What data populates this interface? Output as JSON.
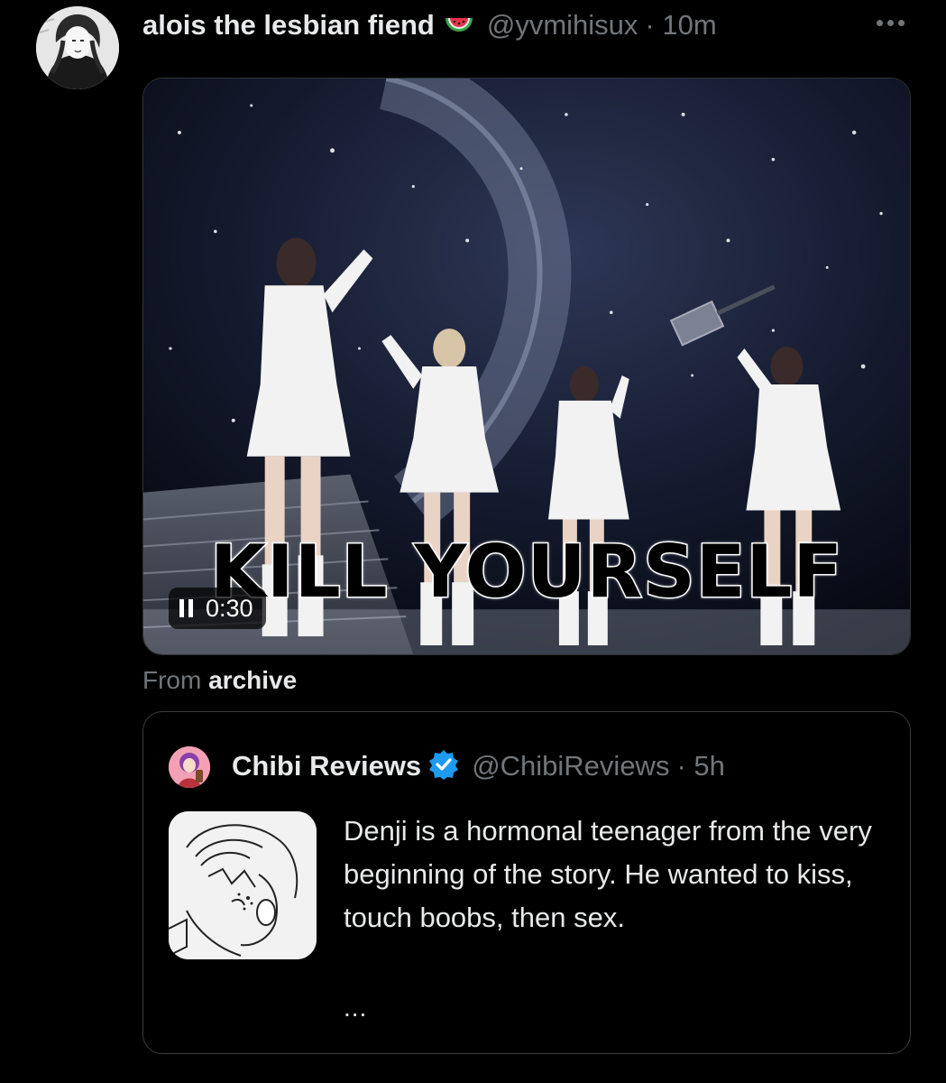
{
  "post": {
    "author_name": "alois the lesbian fiend",
    "author_emoji": "watermelon-icon",
    "handle": "@yvmihisux",
    "time": "· 10m",
    "more_icon": "more-horizontal-icon"
  },
  "video": {
    "caption": "KILL YOURSELF",
    "time_label": "0:30",
    "state_icon": "pause-icon"
  },
  "source": {
    "prefix": "From",
    "name": "archive"
  },
  "quote": {
    "name": "Chibi Reviews",
    "verified_icon": "verified-badge-icon",
    "handle": "@ChibiReviews",
    "time": "· 5h",
    "text": "Denji is a hormonal teenager from the very beginning of the story. He wanted to kiss, touch boobs, then sex.",
    "ellipsis": "..."
  },
  "colors": {
    "background": "#000000",
    "primary_text": "#e7e9ea",
    "secondary_text": "#71767b",
    "verified": "#1d9bf0",
    "border": "#2f3336"
  }
}
